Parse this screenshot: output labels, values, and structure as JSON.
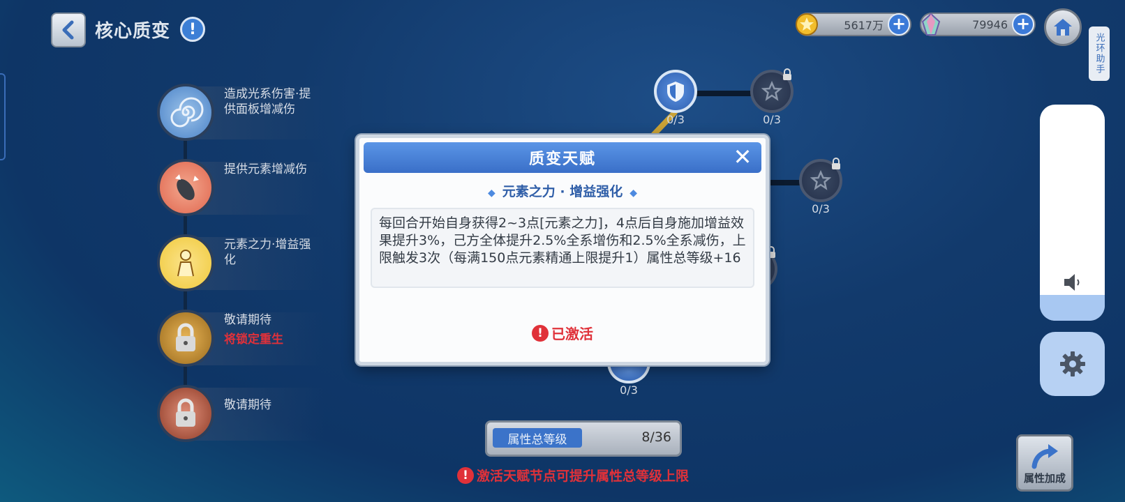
{
  "header": {
    "title": "核心质变",
    "info_symbol": "!"
  },
  "currencies": [
    {
      "name": "gold-coin",
      "value": "5617万"
    },
    {
      "name": "crystal",
      "value": "79946"
    }
  ],
  "assistant_label": "光环助手",
  "talents": [
    {
      "label": "造成光系伤害·提供面板增减伤",
      "icon": "light-spiral-icon",
      "color": "#4a82c7"
    },
    {
      "label": "提供元素增减伤",
      "icon": "rocket-icon",
      "color": "#e0664e"
    },
    {
      "label": "元素之力·增益强化",
      "icon": "buff-figure-icon",
      "color": "#f0c93c"
    },
    {
      "label": "敬请期待",
      "sub": "将锁定重生",
      "icon": "locked-hex-icon",
      "color": "#c58e2e"
    },
    {
      "label": "敬请期待",
      "icon": "locked-burst-icon",
      "color": "#c65a3a"
    }
  ],
  "nodes": [
    {
      "caption": "0/3",
      "icon": "shield-icon",
      "active": true,
      "locked": false
    },
    {
      "caption": "0/3",
      "icon": "star-icon",
      "active": false,
      "locked": true
    },
    {
      "caption": "0/3",
      "icon": "star-icon",
      "active": false,
      "locked": true
    },
    {
      "caption": "/3",
      "icon": "star-icon",
      "active": false,
      "locked": true
    },
    {
      "caption": "0/3",
      "icon": "shield-icon",
      "active": true,
      "locked": false
    }
  ],
  "modal": {
    "title": "质变天赋",
    "subtitle": "元素之力 · 增益强化",
    "description": "每回合开始自身获得2~3点[元素之力]，4点后自身施加增益效果提升3%，己方全体提升2.5%全系增伤和2.5%全系减伤，上限触发3次（每满150点元素精通上限提升1）属性总等级+16",
    "status": "已激活"
  },
  "stats": {
    "label": "属性总等级",
    "value": "8/36"
  },
  "hint": "激活天赋节点可提升属性总等级上限",
  "attr_button": "属性加成",
  "volume_level": 0.12,
  "colors": {
    "accent": "#3b73c9",
    "warning": "#e03139"
  }
}
